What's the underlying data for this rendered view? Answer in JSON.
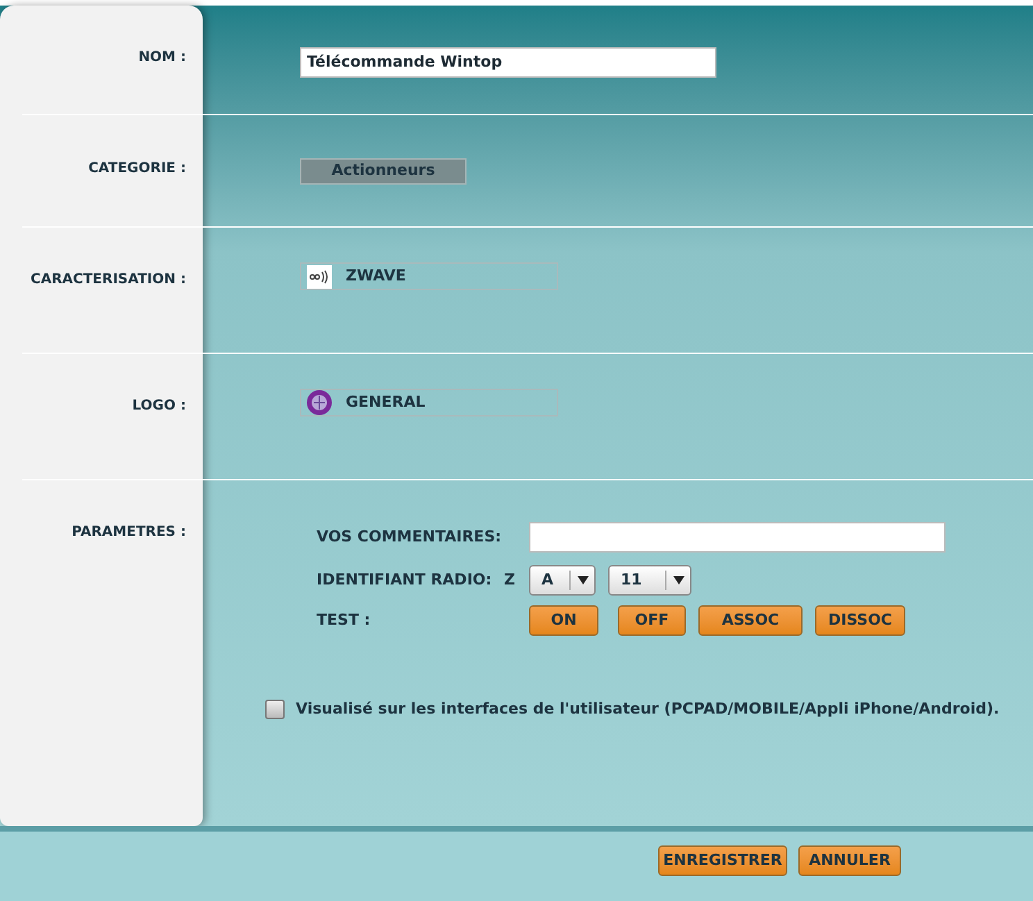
{
  "rows": [
    {
      "label": "NOM :",
      "kind": "text",
      "value": "Télécommande Wintop"
    },
    {
      "label": "CATEGORIE :",
      "kind": "category",
      "value": "Actionneurs"
    },
    {
      "label": "CARACTERISATION :",
      "kind": "protocol",
      "value": "ZWAVE"
    },
    {
      "label": "LOGO :",
      "kind": "logo",
      "value": "GENERAL"
    },
    {
      "label": "PARAMETRES :",
      "kind": "params"
    }
  ],
  "params": {
    "comment_label": "VOS COMMENTAIRES:",
    "radio_label": "IDENTIFIANT RADIO:",
    "radio_prefix": "Z",
    "radio_selects": [
      "A",
      "11"
    ],
    "test_label": "TEST :",
    "test_buttons": [
      "ON",
      "OFF",
      "ASSOC",
      "DISSOC"
    ],
    "visible": {
      "checked": false,
      "label": "Visualisé sur les interfaces de l'utilisateur (PCPAD/MOBILE/Appli iPhone/Android)."
    }
  },
  "footer_buttons": [
    "ENREGISTRER",
    "ANNULER"
  ]
}
